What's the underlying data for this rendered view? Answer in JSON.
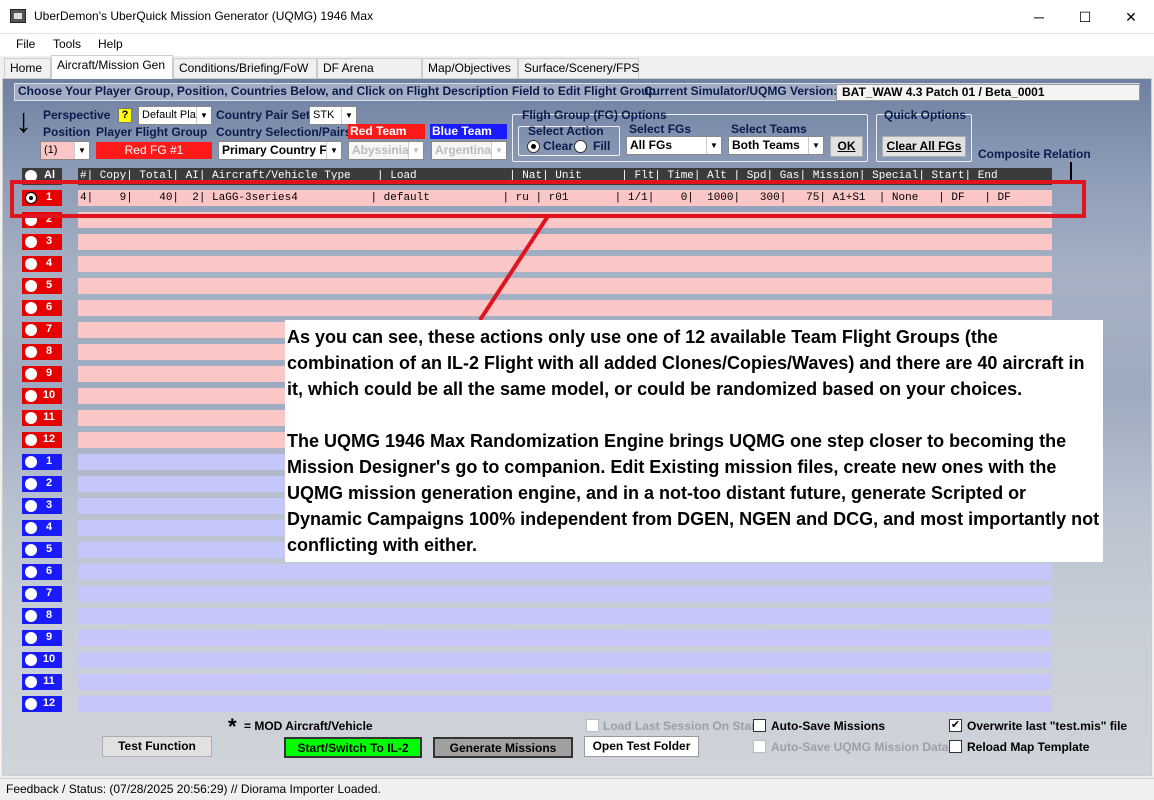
{
  "window": {
    "title": "UberDemon's UberQuick Mission Generator (UQMG) 1946 Max",
    "minimize": "─",
    "maximize": "☐",
    "close": "✕"
  },
  "menu": [
    "File",
    "Tools",
    "Help"
  ],
  "tabs": [
    "Home",
    "Aircraft/Mission Gen",
    "Conditions/Briefing/FoW",
    "DF Arena Options",
    "Map/Objectives",
    "Surface/Scenery/FPS"
  ],
  "header": {
    "instructions": "Choose Your Player Group, Position, Countries Below, and Click on Flight Description Field to Edit Flight Group",
    "version_label": "Current Simulator/UQMG Version:",
    "version_value": "BAT_WAW 4.3 Patch 01 / Beta_0001"
  },
  "controls": {
    "perspective_label": "Perspective",
    "help_badge": "?",
    "perspective_value": "Default Play",
    "position_label": "Position",
    "position_value": "(1)",
    "player_fg_label": "Player Flight Group",
    "player_fg_value": "Red FG #1",
    "country_pair_set_label": "Country Pair Set",
    "country_pair_set_value": "STK",
    "country_selection_label": "Country Selection/Pairs",
    "country_selection_value": "Primary Country F",
    "red_team_label": "Red Team",
    "red_team_value": "Abyssinia",
    "blue_team_label": "Blue Team",
    "blue_team_value": "Argentina",
    "fg_options_label": "Fligh Group (FG) Options",
    "select_action_label": "Select Action",
    "clear_label": "Clear",
    "fill_label": "Fill",
    "select_fgs_label": "Select FGs",
    "select_fgs_value": "All FGs",
    "select_teams_label": "Select Teams",
    "select_teams_value": "Both Teams",
    "ok_label": "OK",
    "quick_options_label": "Quick Options",
    "clear_all_label": "Clear All FGs",
    "composite_label": "Composite Relation",
    "arrow_glyph": "↓"
  },
  "table": {
    "all_label": "Al",
    "header": "#| Copy| Total| AI| Aircraft/Vehicle Type    | Load              | Nat| Unit      | Flt| Time| Alt | Spd| Gas| Mission| Special| Start| End",
    "row1": "4|    9|    40|  2| LaGG-3series4           | default           | ru | r01       | 1/1|    0|  1000|   300|   75| A1+S1  | None   | DF   | DF",
    "red_rows": [
      "1",
      "2",
      "3",
      "4",
      "5",
      "6",
      "7",
      "8",
      "9",
      "10",
      "11",
      "12"
    ],
    "blue_rows": [
      "1",
      "2",
      "3",
      "4",
      "5",
      "6",
      "7",
      "8",
      "9",
      "10",
      "11",
      "12"
    ]
  },
  "callout": {
    "p1": "As you can see, these actions only use one of 12 available Team Flight Groups (the combination of an IL-2 Flight with all added Clones/Copies/Waves) and there are 40 aircraft in it, which could be all the same model, or could be randomized based on your choices.",
    "p2": "The UQMG 1946 Max Randomization Engine brings UQMG one step closer to becoming the Mission Designer's go to companion.  Edit Existing mission files, create new ones with the UQMG mission generation engine, and in a not-too distant future, generate Scripted or Dynamic Campaigns 100% independent from DGEN, NGEN and DCG, and most importantly not conflicting with either."
  },
  "bottom": {
    "mod_star": "*",
    "mod_label": "= MOD Aircraft/Vehicle",
    "test_function": "Test Function",
    "start_switch": "Start/Switch To IL-2",
    "generate": "Generate Missions",
    "open_test_folder": "Open Test Folder",
    "load_last_session": "Load Last Session On Start",
    "auto_save_missions": "Auto-Save Missions",
    "auto_save_uqmg": "Auto-Save UQMG Mission Data",
    "overwrite": "Overwrite last \"test.mis\" file",
    "reload_map": "Reload Map Template",
    "check_mark": "✔"
  },
  "status": "Feedback / Status:  (07/28/2025 20:56:29) // Diorama Importer Loaded.",
  "colors": {
    "red_team": "#e60000",
    "blue_team": "#1a1aff",
    "red_row": "#fbc6c6",
    "blue_row": "#c6c6fb",
    "highlight": "#e0141e",
    "start_button": "#00ff00",
    "generate_button": "#a0a0a0"
  }
}
